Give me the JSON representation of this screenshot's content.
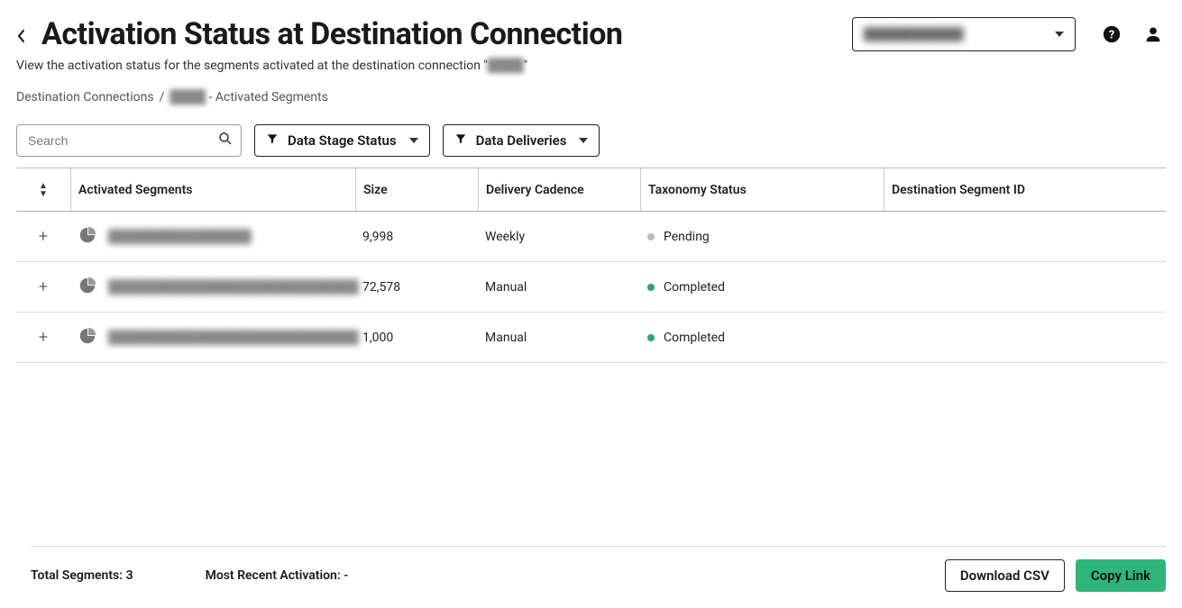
{
  "header": {
    "title": "Activation Status at Destination Connection",
    "subtitle_prefix": "View the activation status for the segments activated at the destination connection \"",
    "subtitle_conn": "████",
    "subtitle_suffix": "\"",
    "account_label": "████████████"
  },
  "breadcrumb": {
    "root": "Destination Connections",
    "sep": "/",
    "conn": "████",
    "leaf": " - Activated Segments"
  },
  "controls": {
    "search_placeholder": "Search",
    "filter_stage": "Data Stage Status",
    "filter_deliveries": "Data Deliveries"
  },
  "columns": {
    "segments": "Activated Segments",
    "size": "Size",
    "cadence": "Delivery Cadence",
    "taxonomy": "Taxonomy Status",
    "dest_id": "Destination Segment ID"
  },
  "rows": [
    {
      "name": "████████████████",
      "size": "9,998",
      "cadence": "Weekly",
      "status": "Pending",
      "status_color": "gray",
      "dest_id": ""
    },
    {
      "name": "████████████████████████████",
      "size": "72,578",
      "cadence": "Manual",
      "status": "Completed",
      "status_color": "green",
      "dest_id": ""
    },
    {
      "name": "████████████████████████████",
      "size": "1,000",
      "cadence": "Manual",
      "status": "Completed",
      "status_color": "green",
      "dest_id": ""
    }
  ],
  "footer": {
    "total_label": "Total Segments: ",
    "total_value": "3",
    "recent_label": "Most Recent Activation: ",
    "recent_value": "-",
    "download": "Download CSV",
    "copy": "Copy Link"
  }
}
